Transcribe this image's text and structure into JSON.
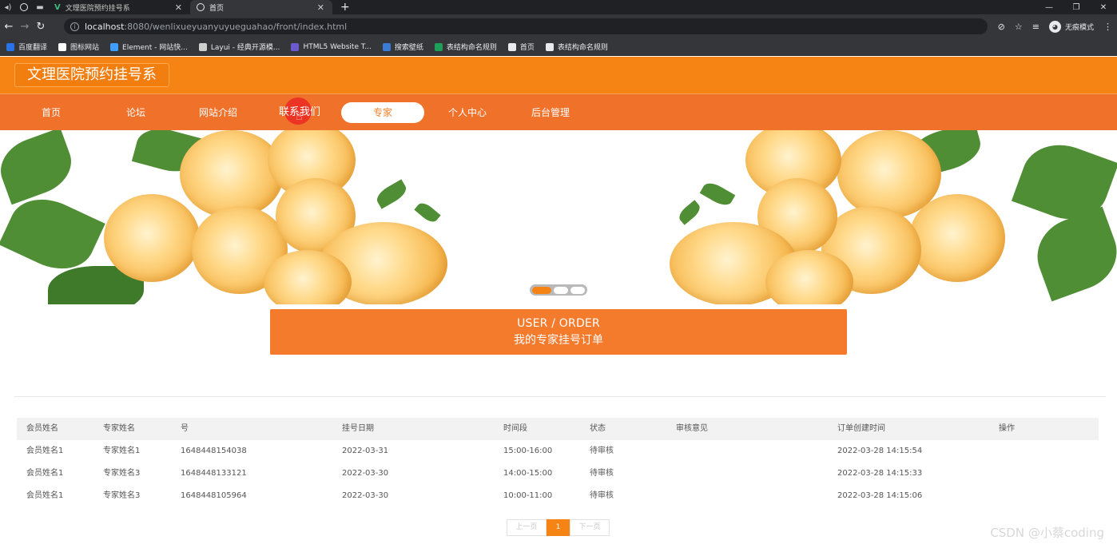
{
  "browser": {
    "tabs": [
      {
        "title": "文理医院预约挂号系",
        "active": false
      },
      {
        "title": "首页",
        "active": true
      }
    ],
    "url_host": "localhost",
    "url_rest": ":8080/wenlixueyuanyuyueguahao/front/index.html",
    "profile_label": "无痕模式",
    "bookmarks": [
      {
        "label": "百度翻译",
        "color": "#2a72e8"
      },
      {
        "label": "图标网站",
        "color": "#ffffff"
      },
      {
        "label": "Element - 网站快...",
        "color": "#409eff"
      },
      {
        "label": "Layui - 经典开源模...",
        "color": "#cfcfcf"
      },
      {
        "label": "HTML5 Website T...",
        "color": "#6a5acd"
      },
      {
        "label": "搜索壁纸",
        "color": "#3a7bd5"
      },
      {
        "label": "表结构命名规则",
        "color": "#1e9e5a"
      },
      {
        "label": "首页",
        "color": "#e8eaed"
      },
      {
        "label": "表结构命名规则",
        "color": "#e8eaed"
      }
    ]
  },
  "site": {
    "title": "文理医院预约挂号系",
    "brand_color": "#f68414",
    "nav": [
      {
        "label": "首页",
        "active": false
      },
      {
        "label": "论坛",
        "active": false
      },
      {
        "label": "网站介绍",
        "active": false
      },
      {
        "label": "联系我们",
        "active": false
      },
      {
        "label": "专家",
        "active": true
      },
      {
        "label": "个人中心",
        "active": false
      },
      {
        "label": "后台管理",
        "active": false
      }
    ]
  },
  "banner": {
    "slides": 3,
    "current_slide": 1
  },
  "orders": {
    "heading_en": "USER / ORDER",
    "heading_cn": "我的专家挂号订单",
    "columns": [
      "会员姓名",
      "专家姓名",
      "号",
      "挂号日期",
      "时间段",
      "状态",
      "审核意见",
      "订单创建时间",
      "操作"
    ],
    "rows": [
      [
        "会员姓名1",
        "专家姓名1",
        "1648448154038",
        "2022-03-31",
        "15:00-16:00",
        "待审核",
        "",
        "2022-03-28 14:15:54",
        ""
      ],
      [
        "会员姓名1",
        "专家姓名3",
        "1648448133121",
        "2022-03-30",
        "14:00-15:00",
        "待审核",
        "",
        "2022-03-28 14:15:33",
        ""
      ],
      [
        "会员姓名1",
        "专家姓名3",
        "1648448105964",
        "2022-03-30",
        "10:00-11:00",
        "待审核",
        "",
        "2022-03-28 14:15:06",
        ""
      ]
    ]
  },
  "pager": {
    "prev": "上一页",
    "current": "1",
    "next": "下一页"
  },
  "watermark": "CSDN @小蔡coding"
}
